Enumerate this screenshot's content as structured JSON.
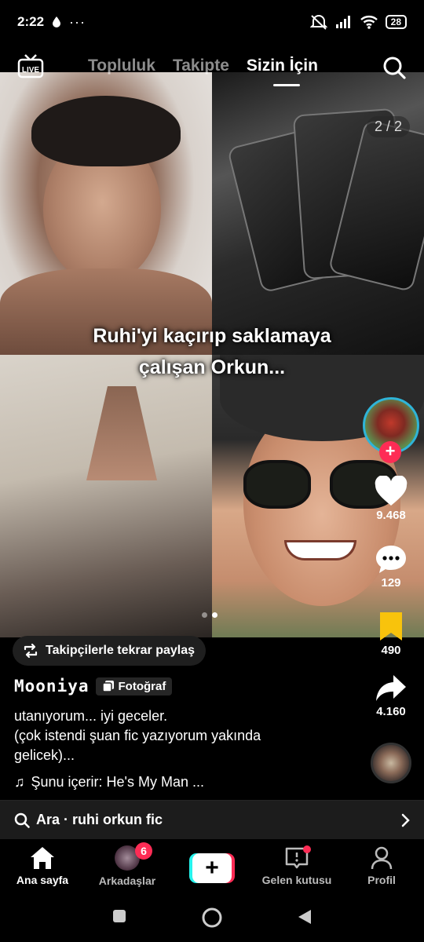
{
  "status_bar": {
    "time": "2:22",
    "battery": "28"
  },
  "top_nav": {
    "tabs": [
      {
        "label": "Topluluk"
      },
      {
        "label": "Takipte"
      },
      {
        "label": "Sizin İçin"
      }
    ],
    "active_tab": "Sizin İçin"
  },
  "post": {
    "image_counter": "2 / 2",
    "caption_lines": [
      "Ruhi'yi kaçırıp  saklamaya",
      "çalışan Orkun..."
    ],
    "repost_label": "Takipçilerle tekrar paylaş",
    "author": "Mooniya",
    "type_badge": "Fotoğraf",
    "description_lines": [
      "utanıyorum... iyi geceler.",
      "(çok istendi şuan fic yazıyorum yakında",
      "gelicek)..."
    ],
    "music": "Şunu içerir: He's My Man ...",
    "likes": "9.468",
    "comments": "129",
    "saves": "490",
    "shares": "4.160",
    "slide_index": 2,
    "slide_total": 2
  },
  "search_bar": {
    "label": "Ara · ruhi orkun fic"
  },
  "bottom_nav": {
    "items": [
      {
        "label": "Ana sayfa"
      },
      {
        "label": "Arkadaşlar",
        "badge": "6"
      },
      {
        "label": ""
      },
      {
        "label": "Gelen kutusu"
      },
      {
        "label": "Profil"
      }
    ]
  },
  "colors": {
    "accent": "#fe2c55",
    "cyan": "#25f4ee",
    "save_yellow": "#f8c30c"
  }
}
